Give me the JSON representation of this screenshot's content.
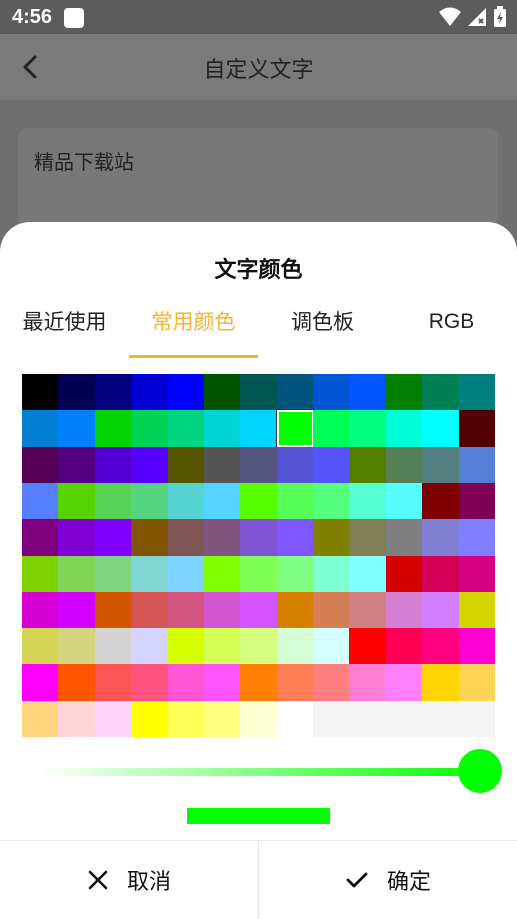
{
  "status_bar": {
    "time": "4:56"
  },
  "app_bar": {
    "title": "自定义文字"
  },
  "text_card": {
    "text": "精品下载站"
  },
  "dialog": {
    "title": "文字颜色",
    "tabs": [
      {
        "label": "最近使用",
        "active": false
      },
      {
        "label": "常用颜色",
        "active": true
      },
      {
        "label": "调色板",
        "active": false
      },
      {
        "label": "RGB",
        "active": false
      }
    ],
    "accent_color": "#f2b52b",
    "selected_color": "#00ff00",
    "selected_index": {
      "row": 1,
      "col": 7
    },
    "palette_rows": [
      [
        "#000000",
        "#000055",
        "#00007f",
        "#0000d4",
        "#0000ff",
        "#005500",
        "#005555",
        "#00557f",
        "#0055d4",
        "#0055ff",
        "#007f00",
        "#007f55",
        "#007f7f"
      ],
      [
        "#007fd4",
        "#007fff",
        "#00d400",
        "#00d455",
        "#00d47f",
        "#00d4d4",
        "#00d4ff",
        "#00ff00",
        "#00ff55",
        "#00ff7f",
        "#00ffd4",
        "#00ffff",
        "#550000"
      ],
      [
        "#550055",
        "#55007f",
        "#5500d4",
        "#5500ff",
        "#555500",
        "#555555",
        "#55557f",
        "#5555d4",
        "#5555ff",
        "#557f00",
        "#557f55",
        "#557f7f",
        "#557fd4"
      ],
      [
        "#557fff",
        "#55d400",
        "#55d455",
        "#55d47f",
        "#55d4d4",
        "#55d4ff",
        "#55ff00",
        "#55ff55",
        "#55ff7f",
        "#55ffd4",
        "#55ffff",
        "#7f0000",
        "#7f0055"
      ],
      [
        "#7f007f",
        "#7f00d4",
        "#7f00ff",
        "#7f5500",
        "#7f5555",
        "#7f557f",
        "#7f55d4",
        "#7f55ff",
        "#7f7f00",
        "#7f7f55",
        "#7f7f7f",
        "#7f7fd4",
        "#7f7fff"
      ],
      [
        "#7fd400",
        "#7fd455",
        "#7fd47f",
        "#7fd4d4",
        "#7fd4ff",
        "#7fff00",
        "#7fff55",
        "#7fff7f",
        "#7fffd4",
        "#7fffff",
        "#d40000",
        "#d40055",
        "#d4007f"
      ],
      [
        "#d400d4",
        "#d400ff",
        "#d45500",
        "#d45555",
        "#d4557f",
        "#d455d4",
        "#d455ff",
        "#d47f00",
        "#d47f55",
        "#d47f7f",
        "#d47fd4",
        "#d47fff",
        "#d4d400"
      ],
      [
        "#d4d455",
        "#d4d47f",
        "#d4d4d4",
        "#d4d4ff",
        "#d4ff00",
        "#d4ff55",
        "#d4ff7f",
        "#d4ffd4",
        "#d4ffff",
        "#ff0000",
        "#ff0055",
        "#ff007f",
        "#ff00d4"
      ],
      [
        "#ff00ff",
        "#ff5500",
        "#ff5555",
        "#ff557f",
        "#ff55d4",
        "#ff55ff",
        "#ff7f00",
        "#ff7f55",
        "#ff7f7f",
        "#ff7fd4",
        "#ff7fff",
        "#ffd400",
        "#ffd455"
      ],
      [
        "#ffd47f",
        "#ffd4d4",
        "#ffd4ff",
        "#ffff00",
        "#ffff55",
        "#ffff7f",
        "#ffffd4",
        "#ffffff",
        "#f4f4f4",
        "#f4f4f4",
        "#f4f4f4",
        "#f4f4f4",
        "#f4f4f4"
      ]
    ],
    "cancel_label": "取消",
    "confirm_label": "确定"
  }
}
